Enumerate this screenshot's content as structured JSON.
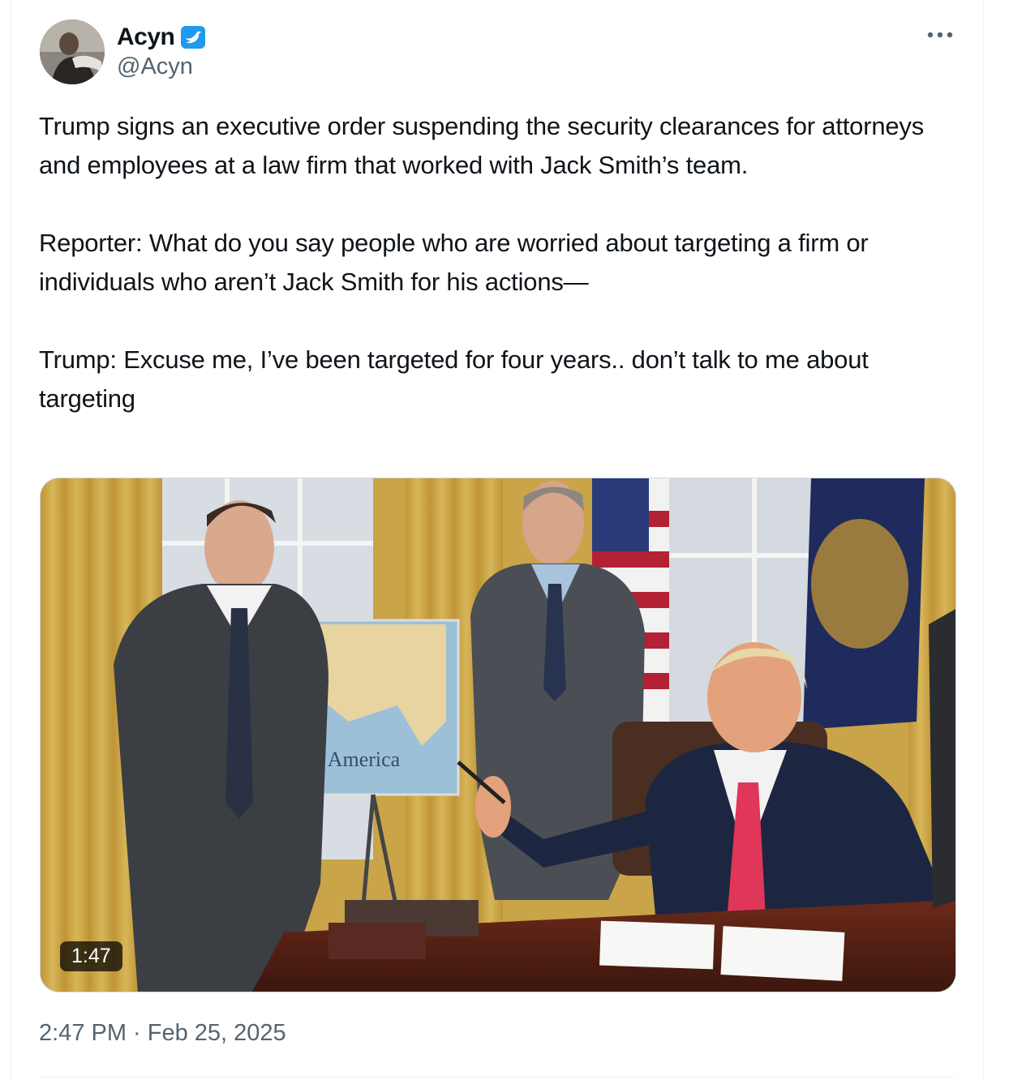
{
  "author": {
    "display_name": "Acyn",
    "handle": "@Acyn",
    "verified_icon": "verified-badge-icon",
    "avatar_icon": "avatar"
  },
  "more_icon": "more-options-icon",
  "tweet": {
    "paragraphs": [
      "Trump signs an executive order suspending the security clearances for attorneys and employees at a law firm that worked with Jack Smith’s team.",
      "Reporter: What do you say people who are worried about targeting a firm or individuals who aren’t Jack Smith for his actions—",
      "Trump: Excuse me, I’ve been targeted for four years.. don’t talk to me about targeting"
    ]
  },
  "media": {
    "duration": "1:47",
    "map_caption": "f America"
  },
  "timestamp": "2:47 PM · Feb 25, 2025",
  "colors": {
    "verified_blue": "#1d9bf0",
    "secondary_text": "#536471",
    "primary_text": "#0f1419"
  }
}
